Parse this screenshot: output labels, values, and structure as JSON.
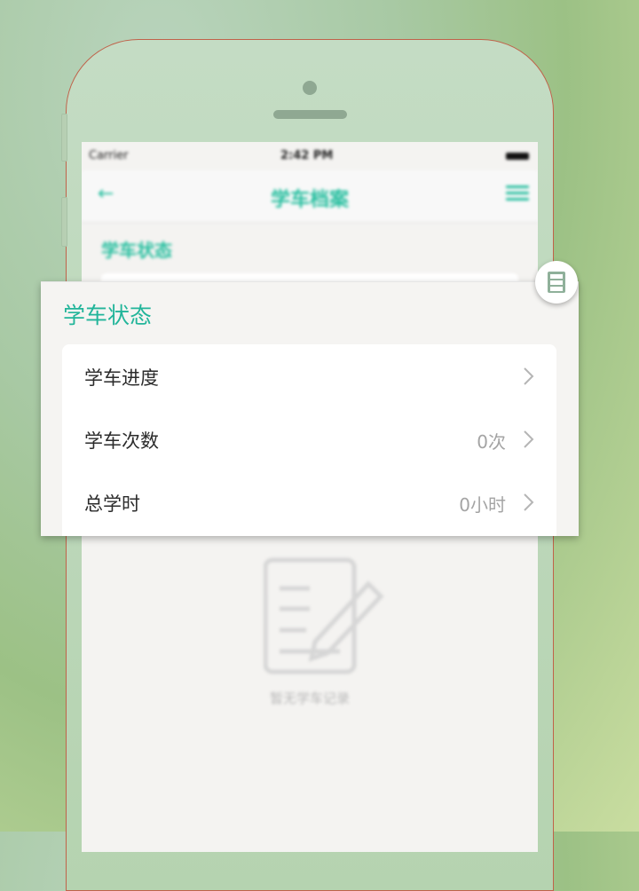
{
  "background_screen": {
    "status_bar": {
      "carrier": "Carrier",
      "time": "2:42 PM"
    },
    "nav": {
      "back_icon": "back-arrow-icon",
      "title": "学车档案",
      "menu_icon": "menu-icon"
    },
    "section_title": "学车状态",
    "empty_state": {
      "icon": "document-edit-icon",
      "text": "暂无学车记录"
    }
  },
  "popup": {
    "title": "学车状态",
    "badge_icon": "drawer-cabinet-icon",
    "rows": [
      {
        "label": "学车进度",
        "value": ""
      },
      {
        "label": "学车次数",
        "value": "0次"
      },
      {
        "label": "总学时",
        "value": "0小时"
      }
    ]
  },
  "colors": {
    "accent": "#22b59a",
    "text": "#2b2b2b",
    "muted": "#a4a4a4"
  }
}
